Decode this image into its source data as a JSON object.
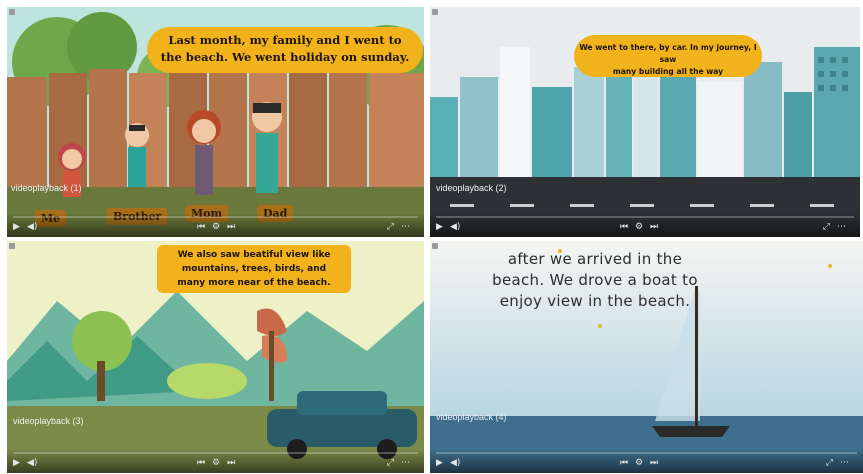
{
  "tiles": [
    {
      "playback_title": "videoplayback (1)",
      "speech_lines": [
        "Last month, my family and I went to",
        "the beach. We went holiday on sunday."
      ],
      "labels": [
        "Me",
        "Brother",
        "Mom",
        "Dad"
      ],
      "progress": 0.0
    },
    {
      "playback_title": "videoplayback (2)",
      "speech_lines": [
        "We went to there, by car. In my journey, I saw",
        "many building all the way"
      ],
      "progress": 0.0
    },
    {
      "playback_title": "videoplayback (3)",
      "speech_lines": [
        "We also saw beatiful view like",
        "mountains, trees, birds, and",
        "many more near of the beach."
      ],
      "progress": 0.0
    },
    {
      "playback_title": "videoplayback (4)",
      "speech_lines": [
        "after we arrived in  the",
        "beach. We drove a boat to",
        "enjoy view in the beach."
      ],
      "progress": 0.0
    }
  ],
  "icons": {
    "play": "play-icon",
    "volume": "volume-icon",
    "fullscreen": "fullscreen-icon",
    "settings": "settings-icon",
    "previous": "previous-icon",
    "next": "next-icon"
  },
  "colors": {
    "speech_bubble": "#f2b21c",
    "fence": "#b5754c",
    "sky_city": "#e8ecee",
    "sea": "#3e6f8e"
  }
}
